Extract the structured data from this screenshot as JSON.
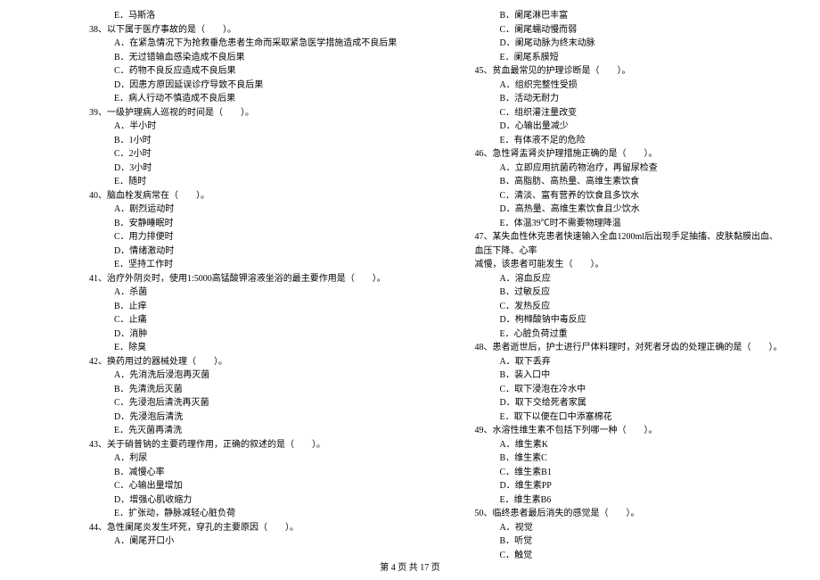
{
  "left_column": {
    "opt_37e": "E．马斯洛",
    "q38": "38、以下属于医疗事故的是（　　）。",
    "q38a": "A．在紧急情况下为抢救垂危患者生命而采取紧急医学措施造成不良后果",
    "q38b": "B．无过错输血感染造成不良后果",
    "q38c": "C．药物不良反应造成不良后果",
    "q38d": "D．因患方原因延误诊疗导致不良后果",
    "q38e": "E．病人行动不慎造成不良后果",
    "q39": "39、一级护理病人巡视的时间是（　　）。",
    "q39a": "A．半小时",
    "q39b": "B．1小时",
    "q39c": "C．2小时",
    "q39d": "D．3小时",
    "q39e": "E．随时",
    "q40": "40、脑血栓发病常在（　　）。",
    "q40a": "A．剧烈运动时",
    "q40b": "B．安静睡眠时",
    "q40c": "C．用力排便时",
    "q40d": "D．情绪激动时",
    "q40e": "E．坚持工作时",
    "q41": "41、治疗外阴炎时，使用1:5000高锰酸钾溶液坐浴的最主要作用是（　　）。",
    "q41a": "A．杀菌",
    "q41b": "B．止痒",
    "q41c": "C．止痛",
    "q41d": "D．消肿",
    "q41e": "E．除臭",
    "q42": "42、换药用过的器械处理（　　）。",
    "q42a": "A．先消洗后浸泡再灭菌",
    "q42b": "B．先清洗后灭菌",
    "q42c": "C．先浸泡后清洗再灭菌",
    "q42d": "D．先浸泡后清洗",
    "q42e": "E．先灭菌再清洗",
    "q43": "43、关于硝普钠的主要药理作用，正确的叙述的是（　　）。",
    "q43a": "A．利尿",
    "q43b": "B．减慢心率",
    "q43c": "C．心输出量增加",
    "q43d": "D．增强心肌收缩力",
    "q43e": "E．扩张动，静脉减轻心脏负荷",
    "q44": "44、急性阑尾炎发生坏死，穿孔的主要原因（　　）。",
    "q44a": "A．阑尾开口小"
  },
  "right_column": {
    "q44b": "B．阑尾淋巴丰富",
    "q44c": "C．阑尾蠕动慢而弱",
    "q44d": "D．阑尾动脉为终末动脉",
    "q44e": "E．阑尾系膜短",
    "q45": "45、贫血最常见的护理诊断是（　　）。",
    "q45a": "A．组织完整性受损",
    "q45b": "B．活动无耐力",
    "q45c": "C．组织灌注量改变",
    "q45d": "D．心输出量减少",
    "q45e": "E．有体液不足的危险",
    "q46": "46、急性肾盂肾炎护理措施正确的是（　　）。",
    "q46a": "A．立即应用抗菌药物治疗，再留尿检查",
    "q46b": "B．高脂肪、高热量、高维生素饮食",
    "q46c": "C．清淡、富有营养的饮食且多饮水",
    "q46d": "D．高热量、高维生素饮食且少饮水",
    "q46e": "E．体温39℃时不需要物理降温",
    "q47": "47、某失血性休克患者快速输入全血1200ml后出现手足抽搐、皮肤黏膜出血、血压下降、心率",
    "q47cont": "减慢，该患者可能发生（　　）。",
    "q47a": "A．溶血反应",
    "q47b": "B．过敏反应",
    "q47c": "C．发热反应",
    "q47d": "D．枸橼酸钠中毒反应",
    "q47e": "E．心脏负荷过重",
    "q48": "48、患者逝世后，护士进行尸体料理时，对死者牙齿的处理正确的是（　　）。",
    "q48a": "A．取下丢弃",
    "q48b": "B．装入口中",
    "q48c": "C．取下浸泡在冷水中",
    "q48d": "D．取下交给死者家属",
    "q48e": "E．取下以便在口中添塞棉花",
    "q49": "49、水溶性维生素不包括下列哪一种（　　）。",
    "q49a": "A．维生素K",
    "q49b": "B．维生素C",
    "q49c": "C．维生素B1",
    "q49d": "D．维生素PP",
    "q49e": "E．维生素B6",
    "q50": "50、临终患者最后消失的感觉是（　　）。",
    "q50a": "A．视觉",
    "q50b": "B．听觉",
    "q50c": "C．触觉"
  },
  "footer": "第 4 页 共 17 页"
}
